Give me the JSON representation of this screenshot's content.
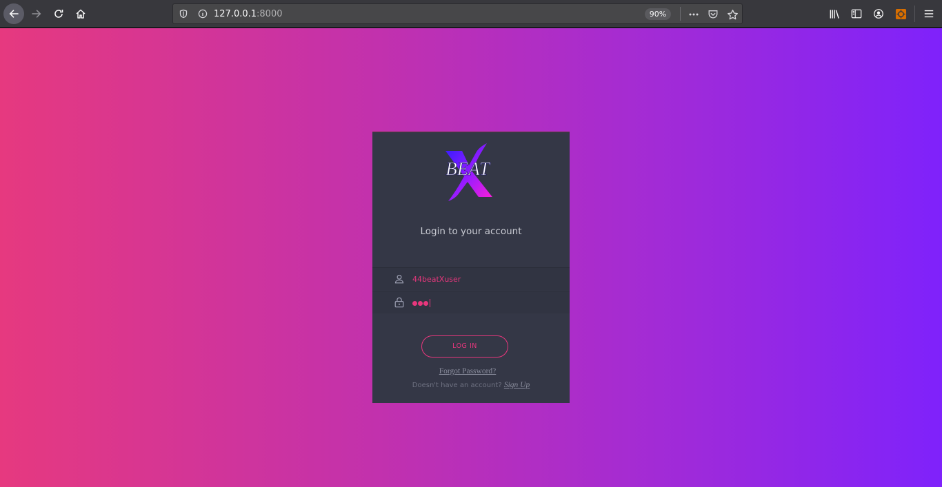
{
  "browser": {
    "url_host": "127.0.0.1",
    "url_port": ":8000",
    "zoom": "90%"
  },
  "login": {
    "brand_text": "BEAT",
    "title": "Login to your account",
    "username_value": "44beatXuser",
    "password_length": 3,
    "login_button": "LOG IN",
    "forgot_link": "Forgot Password?",
    "signup_prompt": "Doesn't have an account?",
    "signup_link": "Sign Up"
  },
  "colors": {
    "accent": "#e8377d",
    "card_bg": "#343746",
    "gradient_start": "#e6397f",
    "gradient_end": "#7f22fb"
  },
  "icons": {
    "back": "arrow-left-icon",
    "forward": "arrow-right-icon",
    "reload": "reload-icon",
    "home": "home-icon",
    "username": "user-icon",
    "password": "lock-icon"
  }
}
